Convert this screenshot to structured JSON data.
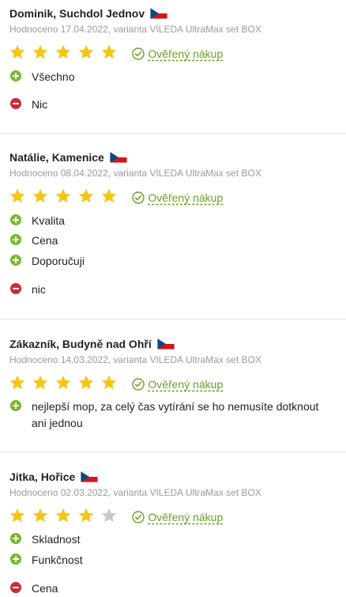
{
  "reviews": [
    {
      "name": "Dominik, Suchdol Jednov",
      "meta": "Hodnoceno 17.04.2022, varianta VILEDA UltraMax set BOX",
      "rating": 5,
      "verified": "Ověřený nákup",
      "pros": [
        "Všechno"
      ],
      "cons": [
        "Nic"
      ]
    },
    {
      "name": "Natálie, Kamenice",
      "meta": "Hodnoceno 08.04.2022, varianta VILEDA UltraMax set BOX",
      "rating": 5,
      "verified": "Ověřený nákup",
      "pros": [
        "Kvalita",
        "Cena",
        "Doporučuji"
      ],
      "cons": [
        "nic"
      ]
    },
    {
      "name": "Zákazník, Budyně nad Ohří",
      "meta": "Hodnoceno 14.03.2022, varianta VILEDA UltraMax set BOX",
      "rating": 5,
      "verified": "Ověřený nákup",
      "pros": [
        "nejlepší mop, za celý čas vytírání se ho nemusíte dotknout ani jednou"
      ],
      "cons": []
    },
    {
      "name": "Jitka, Hořice",
      "meta": "Hodnoceno 02.03.2022, varianta VILEDA UltraMax set BOX",
      "rating": 4,
      "verified": "Ověřený nákup",
      "pros": [
        "Skladnost",
        "Funkčnost"
      ],
      "cons": [
        "Cena"
      ]
    }
  ],
  "colors": {
    "star_filled": "#f5c518",
    "star_empty": "#c9c9c9",
    "verified_green": "#6c9f29",
    "plus_green": "#76b82a",
    "minus_red": "#cc2a3a",
    "meta_gray": "#9a9a9a"
  },
  "icons": {
    "flag": "czech-flag-icon",
    "star": "star-icon",
    "verified": "check-circle-icon",
    "pro": "plus-circle-icon",
    "con": "minus-circle-icon"
  }
}
